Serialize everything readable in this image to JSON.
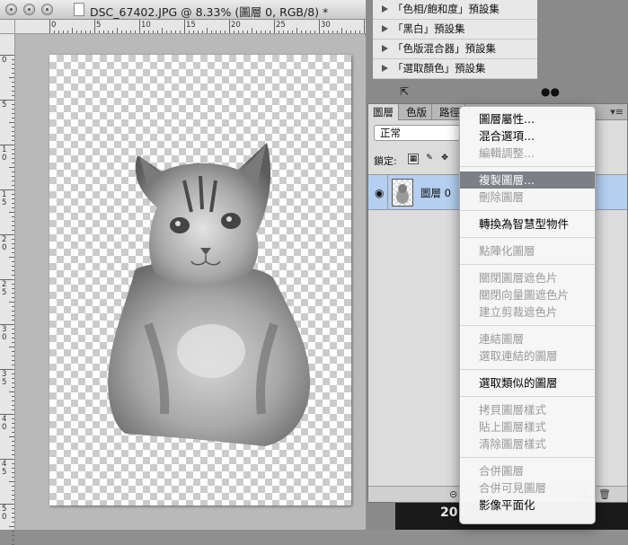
{
  "document": {
    "title": "DSC_67402.JPG @ 8.33% (圖層 0, RGB/8) *",
    "ruler_top_labels": [
      "0",
      "5",
      "10",
      "15",
      "20",
      "25",
      "30",
      "35"
    ],
    "ruler_left_labels": [
      "0",
      "5",
      "1 0",
      "1 5",
      "2 0",
      "2 5",
      "3 0",
      "3 5",
      "4 0",
      "4 5",
      "5 0"
    ]
  },
  "adjustment_presets": [
    "「色相/飽和度」預設集",
    "「黑白」預設集",
    "「色版混合器」預設集",
    "「選取顏色」預設集"
  ],
  "layers_panel": {
    "tabs": [
      "圖層",
      "色版",
      "路徑"
    ],
    "blend_mode": "正常",
    "lock_label": "鎖定:",
    "layer_name": "圖層 0"
  },
  "context_menu": {
    "groups": [
      [
        {
          "label": "圖層屬性...",
          "enabled": true
        },
        {
          "label": "混合選項...",
          "enabled": true
        },
        {
          "label": "編輯調整...",
          "enabled": false
        }
      ],
      [
        {
          "label": "複製圖層...",
          "enabled": true,
          "highlighted": true
        },
        {
          "label": "刪除圖層",
          "enabled": false
        }
      ],
      [
        {
          "label": "轉換為智慧型物件",
          "enabled": true
        }
      ],
      [
        {
          "label": "點陣化圖層",
          "enabled": false
        }
      ],
      [
        {
          "label": "關閉圖層遮色片",
          "enabled": false
        },
        {
          "label": "關閉向量圖遮色片",
          "enabled": false
        },
        {
          "label": "建立剪裁遮色片",
          "enabled": false
        }
      ],
      [
        {
          "label": "連結圖層",
          "enabled": false
        },
        {
          "label": "選取連結的圖層",
          "enabled": false
        }
      ],
      [
        {
          "label": "選取類似的圖層",
          "enabled": true
        }
      ],
      [
        {
          "label": "拷貝圖層樣式",
          "enabled": false
        },
        {
          "label": "貼上圖層樣式",
          "enabled": false
        },
        {
          "label": "清除圖層樣式",
          "enabled": false
        }
      ],
      [
        {
          "label": "合併圖層",
          "enabled": false
        },
        {
          "label": "合併可見圖層",
          "enabled": false
        },
        {
          "label": "影像平面化",
          "enabled": true
        }
      ]
    ]
  },
  "background_photo_text": "201"
}
